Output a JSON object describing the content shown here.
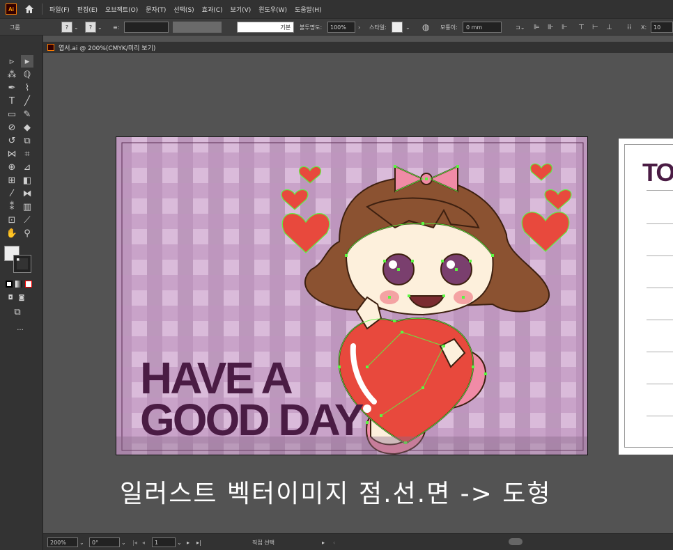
{
  "menubar": {
    "logo": "Ai",
    "items": [
      "파일(F)",
      "편집(E)",
      "오브젝트(O)",
      "문자(T)",
      "선택(S)",
      "효과(C)",
      "보기(V)",
      "윈도우(W)",
      "도움말(H)"
    ]
  },
  "controlbar": {
    "selection_label": "그룹",
    "stroke_style": "기본",
    "opacity_label": "불투명도:",
    "opacity_value": "100%",
    "style_label": "스타일:",
    "corner_label": "모퉁이:",
    "corner_value": "0 mm",
    "x_label": "X:",
    "x_value": "10"
  },
  "document": {
    "tab_title": "엽서.ai @ 200%(CMYK/미리 보기)"
  },
  "artwork": {
    "headline_line1": "HAVE A",
    "headline_line2": "GOOD DAY",
    "to_label": "TO"
  },
  "caption": "일러스트 벡터이미지 점.선.면 -> 도형",
  "statusbar": {
    "zoom": "200%",
    "rotation": "0°",
    "artboard_number": "1",
    "tool_name": "직접 선택"
  },
  "colors": {
    "plaid_base": "#c9a3c9",
    "headline": "#4a1c44",
    "heart_red": "#e8493d",
    "hair_brown": "#8b5231",
    "ribbon_pink": "#f08ba6",
    "anchor_green": "#5cf542"
  }
}
